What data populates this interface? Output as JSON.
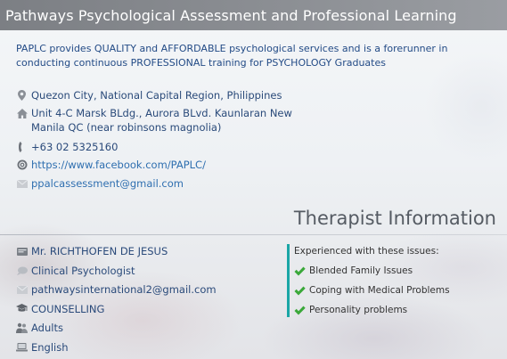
{
  "header": {
    "title": "Pathways Psychological Assessment and Professional Learning"
  },
  "intro": {
    "text": "PAPLC provides QUALITY and AFFORDABLE psychological services and is a forerunner in conducting continuous PROFESSIONAL training for PSYCHOLOGY Graduates"
  },
  "contact": {
    "location": {
      "icon": "map-pin-icon",
      "text": "Quezon City, National Capital Region, Philippines"
    },
    "address": {
      "icon": "home-icon",
      "text": "Unit 4-C Marsk BLdg., Aurora BLvd. Kaunlaran New Manila QC (near robinsons magnolia)"
    },
    "phone": {
      "icon": "phone-icon",
      "text": "+63 02 5325160"
    },
    "website": {
      "icon": "globe-icon",
      "text": "https://www.facebook.com/PAPLC/"
    },
    "email": {
      "icon": "envelope-icon",
      "text": "ppalcassessment@gmail.com"
    }
  },
  "therapist_section": {
    "heading": "Therapist Information"
  },
  "therapist": {
    "name": {
      "icon": "id-card-icon",
      "text": "Mr. RICHTHOFEN DE JESUS"
    },
    "title": {
      "icon": "speech-bubble-icon",
      "text": "Clinical Psychologist"
    },
    "email": {
      "icon": "envelope-icon",
      "text": "pathwaysinternational2@gmail.com"
    },
    "service": {
      "icon": "graduation-cap-icon",
      "text": "COUNSELLING"
    },
    "age_group": {
      "icon": "people-icon",
      "text": "Adults"
    },
    "language": {
      "icon": "laptop-icon",
      "text": "English"
    }
  },
  "issues": {
    "title": "Experienced with these issues:",
    "items": [
      "Blended Family Issues",
      "Coping with Medical Problems",
      "Personality problems"
    ],
    "check_color": "#3aa83a",
    "accent_color": "#1aa6a6"
  }
}
